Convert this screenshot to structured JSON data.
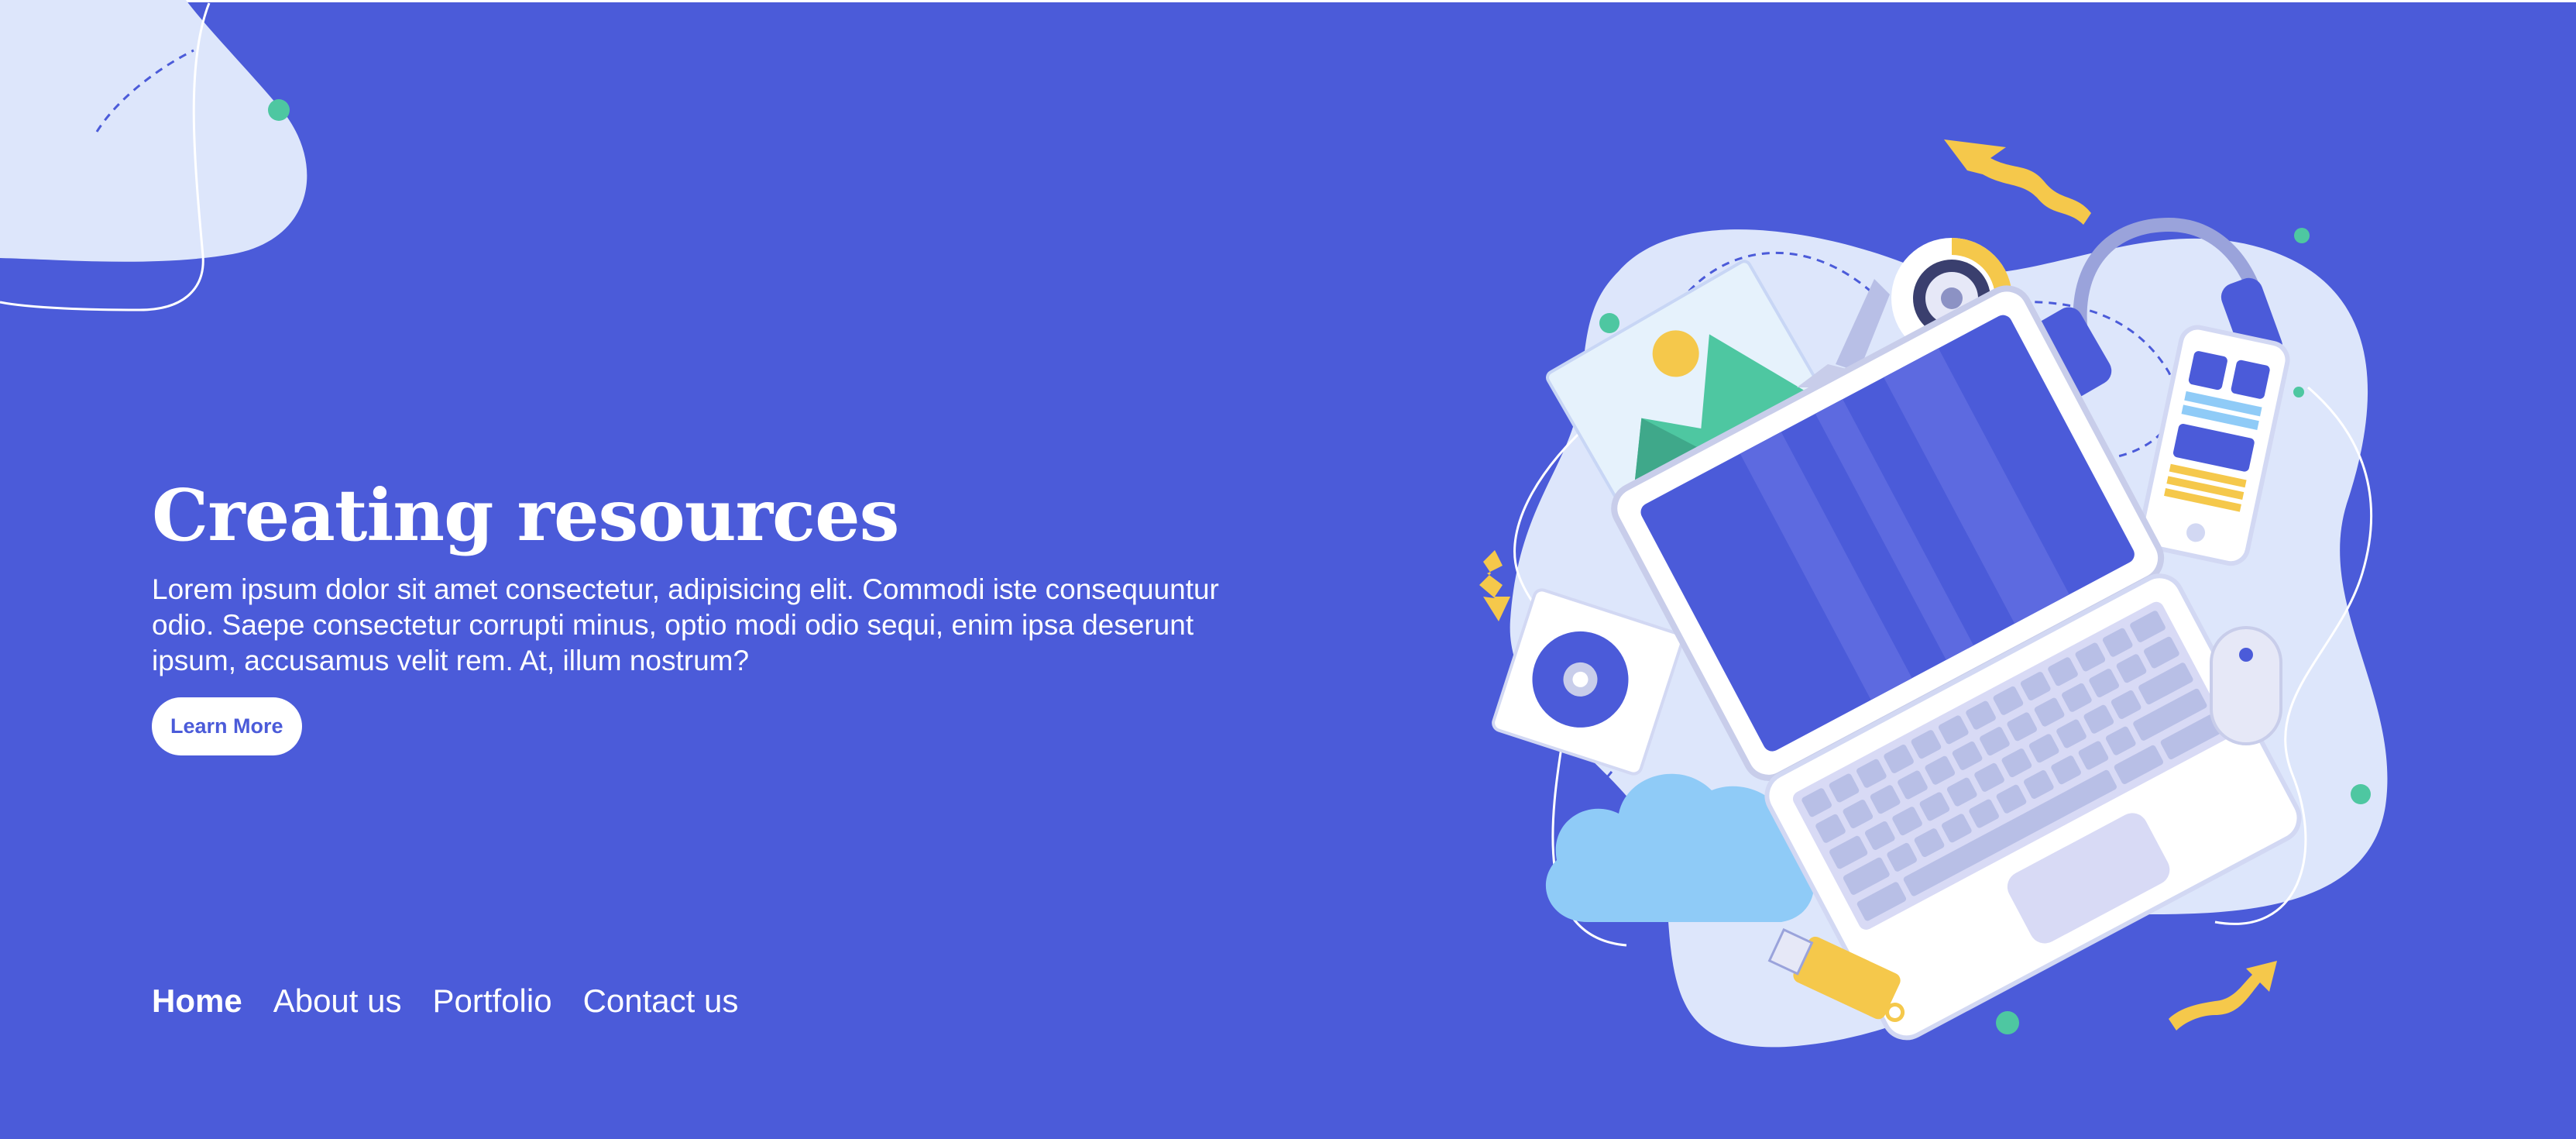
{
  "hero": {
    "title": "Creating resources",
    "body": "Lorem ipsum dolor sit amet consectetur, adipisicing elit. Commodi iste consequuntur odio. Saepe consectetur corrupti minus, optio modi odio sequi, enim ipsa deserunt ipsum, accusamus velit rem. At, illum nostrum?",
    "cta_label": "Learn More"
  },
  "nav": {
    "items": [
      {
        "label": "Home",
        "active": true
      },
      {
        "label": "About us",
        "active": false
      },
      {
        "label": "Portfolio",
        "active": false
      },
      {
        "label": "Contact us",
        "active": false
      }
    ]
  },
  "colors": {
    "background": "#4b5bd9",
    "blob": "#dde6fb",
    "accent_yellow": "#f5c84b",
    "accent_green": "#4ec7a1",
    "cloud": "#8fcbf7"
  },
  "illustration": {
    "icons": [
      "laptop-icon",
      "webcam-icon",
      "headphones-icon",
      "smartphone-icon",
      "mouse-icon",
      "hard-drive-icon",
      "photo-icon",
      "cloud-icon",
      "usb-drive-icon"
    ]
  }
}
